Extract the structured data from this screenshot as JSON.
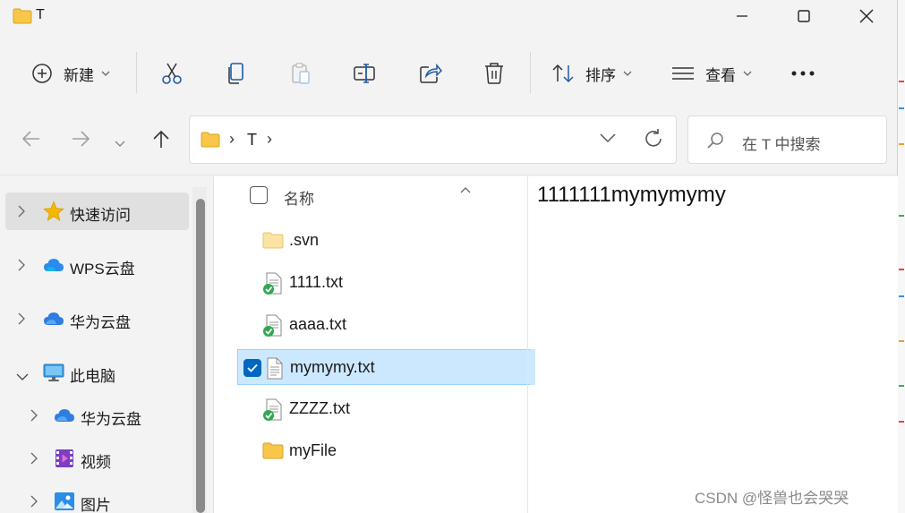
{
  "window": {
    "title": "T"
  },
  "toolbar": {
    "new_label": "新建",
    "sort_label": "排序",
    "view_label": "查看"
  },
  "address": {
    "path": "T",
    "search_placeholder": "在 T 中搜索"
  },
  "nav": {
    "items": [
      {
        "label": "快速访问"
      },
      {
        "label": "WPS云盘"
      },
      {
        "label": "华为云盘"
      },
      {
        "label": "此电脑"
      },
      {
        "label": "华为云盘"
      },
      {
        "label": "视频"
      },
      {
        "label": "图片"
      }
    ]
  },
  "files": {
    "header": "名称",
    "items": [
      {
        "name": ".svn"
      },
      {
        "name": "1111.txt"
      },
      {
        "name": "aaaa.txt"
      },
      {
        "name": "mymymy.txt"
      },
      {
        "name": "ZZZZ.txt"
      },
      {
        "name": "myFile"
      }
    ]
  },
  "preview": {
    "text": "1111111mymymymy"
  },
  "watermark": "CSDN @怪兽也会哭哭",
  "colors": {
    "accent": "#0067c0",
    "selection": "#cce8ff",
    "folder": "#f8c74a"
  }
}
